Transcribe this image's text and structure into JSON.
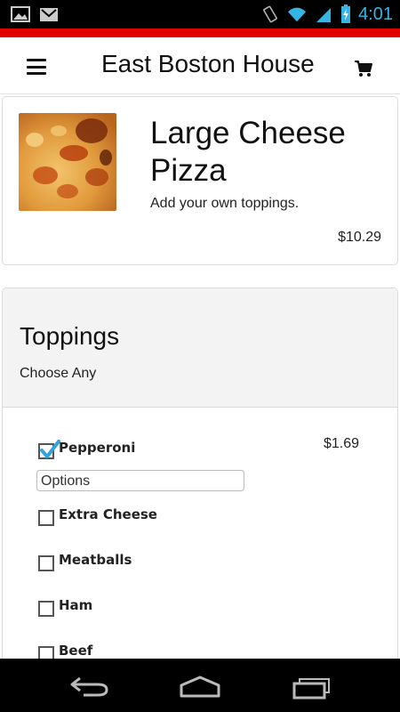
{
  "status_bar": {
    "time": "4:01",
    "icons": [
      "image-icon",
      "gmail-icon",
      "vibrate-icon",
      "wifi-icon",
      "signal-icon",
      "battery-charging-icon"
    ],
    "clock_color": "#33b5e5"
  },
  "header": {
    "title": "East Boston House of Pizza",
    "accent_color": "#e00000",
    "icons": [
      "menu-icon",
      "cart-icon"
    ]
  },
  "product": {
    "title": "Large Cheese Pizza",
    "description": "Add your own toppings.",
    "price": "$10.29"
  },
  "toppings": {
    "title": "Toppings",
    "subtitle": "Choose Any",
    "options_placeholder": "Options",
    "items": [
      {
        "label": "Pepperoni",
        "price": "$1.69",
        "checked": true
      },
      {
        "label": "Extra Cheese",
        "price": "",
        "checked": false
      },
      {
        "label": "Meatballs",
        "price": "",
        "checked": false
      },
      {
        "label": "Ham",
        "price": "",
        "checked": false
      },
      {
        "label": "Beef",
        "price": "",
        "checked": false
      }
    ]
  },
  "nav_bar": {
    "icons": [
      "back-icon",
      "home-icon",
      "recent-apps-icon"
    ]
  }
}
